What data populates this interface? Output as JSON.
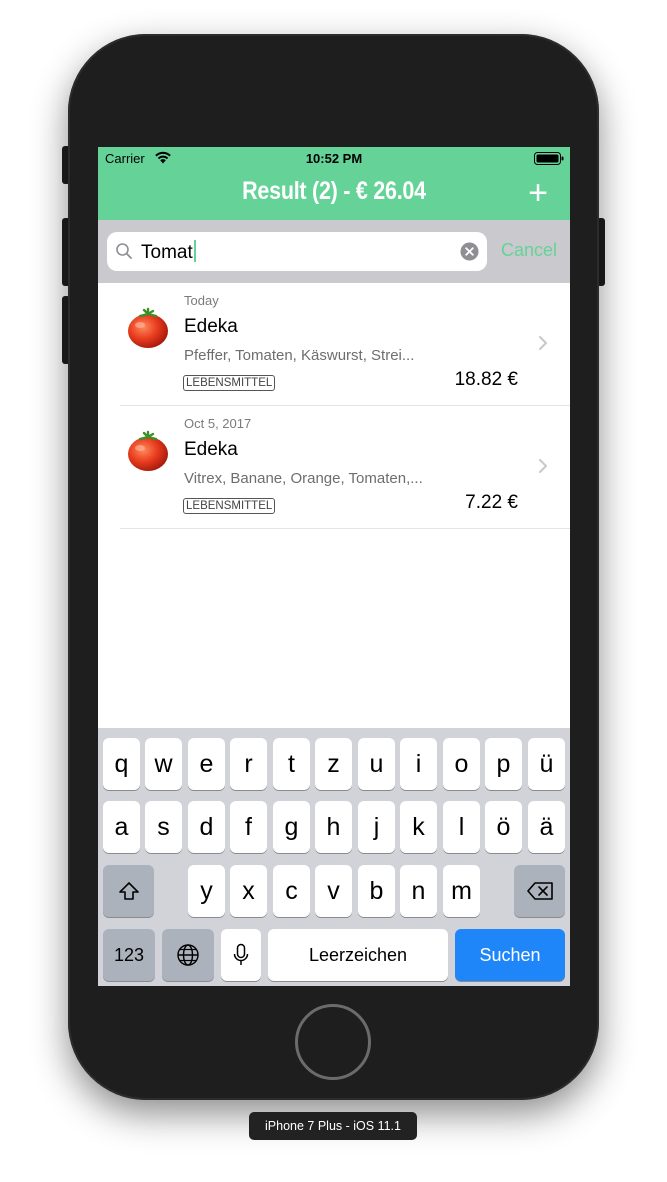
{
  "status_bar": {
    "carrier": "Carrier",
    "time": "10:52 PM"
  },
  "nav": {
    "title": "Result (2) - € 26.04",
    "add_label": "+"
  },
  "search": {
    "value": "Tomat",
    "cancel_label": "Cancel"
  },
  "results": [
    {
      "date": "Today",
      "title": "Edeka",
      "items": "Pfeffer, Tomaten, Käswurst, Strei...",
      "tag": "LEBENSMITTEL",
      "amount": "18.82 €",
      "icon": "tomato-icon"
    },
    {
      "date": "Oct 5, 2017",
      "title": "Edeka",
      "items": "Vitrex, Banane, Orange, Tomaten,...",
      "tag": "LEBENSMITTEL",
      "amount": "7.22 €",
      "icon": "tomato-icon"
    }
  ],
  "keyboard": {
    "row1": [
      "q",
      "w",
      "e",
      "r",
      "t",
      "z",
      "u",
      "i",
      "o",
      "p",
      "ü"
    ],
    "row2": [
      "a",
      "s",
      "d",
      "f",
      "g",
      "h",
      "j",
      "k",
      "l",
      "ö",
      "ä"
    ],
    "row3": [
      "y",
      "x",
      "c",
      "v",
      "b",
      "n",
      "m"
    ],
    "numbers_label": "123",
    "space_label": "Leerzeichen",
    "search_label": "Suchen"
  },
  "device_label": "iPhone 7 Plus - iOS 11.1",
  "colors": {
    "accent": "#65d398",
    "key_blue": "#1f86fa"
  }
}
